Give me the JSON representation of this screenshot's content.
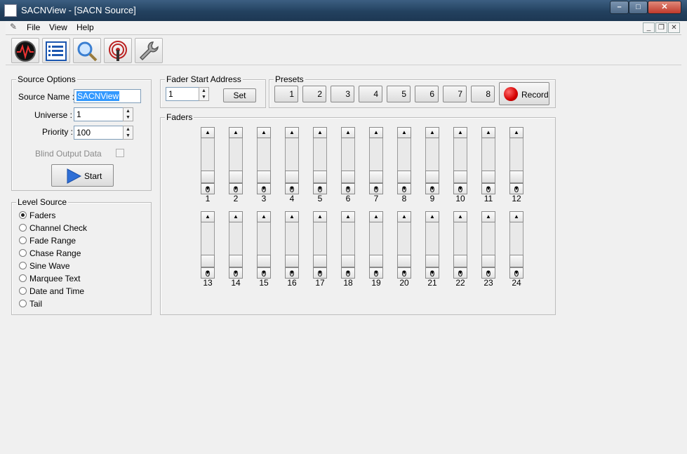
{
  "window": {
    "title": "SACNView - [SACN Source]"
  },
  "menu": [
    "File",
    "View",
    "Help"
  ],
  "toolbar": [
    "scope-icon",
    "list-icon",
    "magnifier-icon",
    "antenna-icon",
    "wrench-icon"
  ],
  "source_options": {
    "label": "Source Options",
    "source_name_label": "Source Name :",
    "source_name_value": "SACNView",
    "universe_label": "Universe :",
    "universe_value": "1",
    "priority_label": "Priority :",
    "priority_value": "100",
    "blind_label": "Blind Output Data",
    "start_label": "Start"
  },
  "fader_start": {
    "label": "Fader Start Address",
    "value": "1",
    "set_label": "Set"
  },
  "presets": {
    "label": "Presets",
    "buttons": [
      "1",
      "2",
      "3",
      "4",
      "5",
      "6",
      "7",
      "8"
    ],
    "record_label": "Record"
  },
  "level_source": {
    "label": "Level Source",
    "options": [
      "Faders",
      "Channel Check",
      "Fade Range",
      "Chase Range",
      "Sine Wave",
      "Marquee Text",
      "Date and Time",
      "Tail"
    ],
    "selected": "Faders"
  },
  "faders": {
    "label": "Faders",
    "channels": [
      {
        "num": "1",
        "value": "0"
      },
      {
        "num": "2",
        "value": "0"
      },
      {
        "num": "3",
        "value": "0"
      },
      {
        "num": "4",
        "value": "0"
      },
      {
        "num": "5",
        "value": "0"
      },
      {
        "num": "6",
        "value": "0"
      },
      {
        "num": "7",
        "value": "0"
      },
      {
        "num": "8",
        "value": "0"
      },
      {
        "num": "9",
        "value": "0"
      },
      {
        "num": "10",
        "value": "0"
      },
      {
        "num": "11",
        "value": "0"
      },
      {
        "num": "12",
        "value": "0"
      },
      {
        "num": "13",
        "value": "0"
      },
      {
        "num": "14",
        "value": "0"
      },
      {
        "num": "15",
        "value": "0"
      },
      {
        "num": "16",
        "value": "0"
      },
      {
        "num": "17",
        "value": "0"
      },
      {
        "num": "18",
        "value": "0"
      },
      {
        "num": "19",
        "value": "0"
      },
      {
        "num": "20",
        "value": "0"
      },
      {
        "num": "21",
        "value": "0"
      },
      {
        "num": "22",
        "value": "0"
      },
      {
        "num": "23",
        "value": "0"
      },
      {
        "num": "24",
        "value": "0"
      }
    ]
  },
  "colors": {
    "titlebar": "#23415f",
    "record": "#d40000",
    "start": "#2f6fd6"
  }
}
